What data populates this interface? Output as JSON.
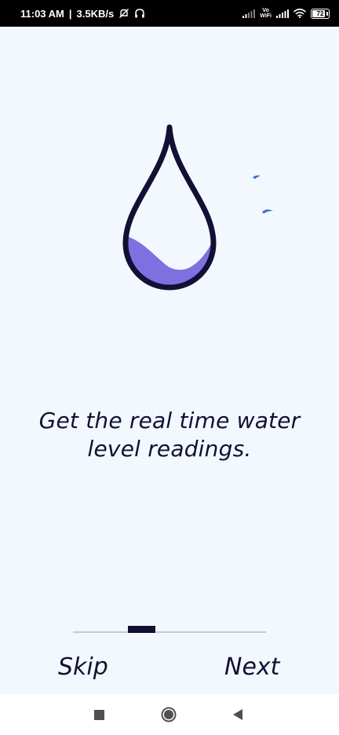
{
  "status_bar": {
    "time": "11:03 AM",
    "speed": "3.5KB/s",
    "volte_top": "Vo",
    "volte_bottom": "WiFi",
    "battery": "72",
    "icons": [
      "mute-bell-icon",
      "headphones-icon",
      "signal-icon",
      "wifi-icon",
      "battery-icon"
    ]
  },
  "illustration": {
    "icon": "water-drop-icon",
    "outline_color": "#121033",
    "water_color": "#7f6fe0",
    "splash_color": "#3a6fc4",
    "water_level": 0.3
  },
  "onboarding": {
    "message_line1": "Get the real time water",
    "message_line2": "level readings.",
    "page_indicator": {
      "current": 2,
      "total": 7
    },
    "skip_label": "Skip",
    "next_label": "Next"
  },
  "system_nav": {
    "icons": [
      "recents-icon",
      "home-icon",
      "back-icon"
    ]
  }
}
